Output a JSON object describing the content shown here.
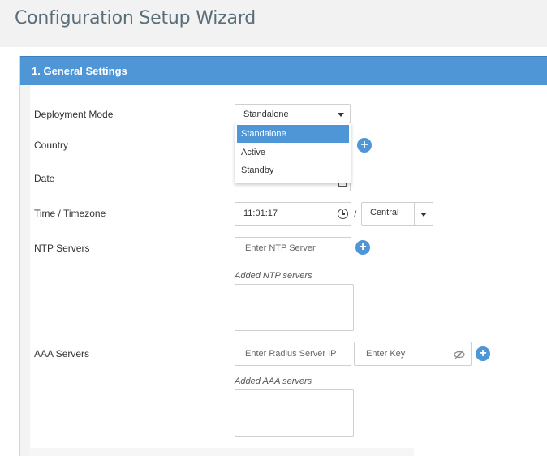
{
  "page": {
    "title": "Configuration Setup Wizard"
  },
  "section": {
    "title": "1. General Settings"
  },
  "fields": {
    "deployment_mode": {
      "label": "Deployment Mode",
      "value": "Standalone",
      "options": [
        "Standalone",
        "Active",
        "Standby"
      ],
      "selected_option": "Standalone"
    },
    "country": {
      "label": "Country"
    },
    "date": {
      "label": "Date"
    },
    "time": {
      "label": "Time / Timezone",
      "value": "11:01:17",
      "separator": "/",
      "timezone": "Central"
    },
    "ntp": {
      "label": "NTP Servers",
      "placeholder": "Enter NTP Server",
      "list_label": "Added NTP servers"
    },
    "aaa": {
      "label": "AAA Servers",
      "ip_placeholder": "Enter Radius Server IP",
      "key_placeholder": "Enter Key",
      "list_label": "Added AAA servers"
    }
  },
  "icons": {
    "plus": "plus-circle-icon",
    "clock": "clock-icon",
    "eye_off": "eye-off-icon",
    "calendar": "calendar-icon",
    "caret": "caret-down-icon"
  },
  "colors": {
    "accent": "#4f96d6",
    "title": "#5a6e7a"
  }
}
